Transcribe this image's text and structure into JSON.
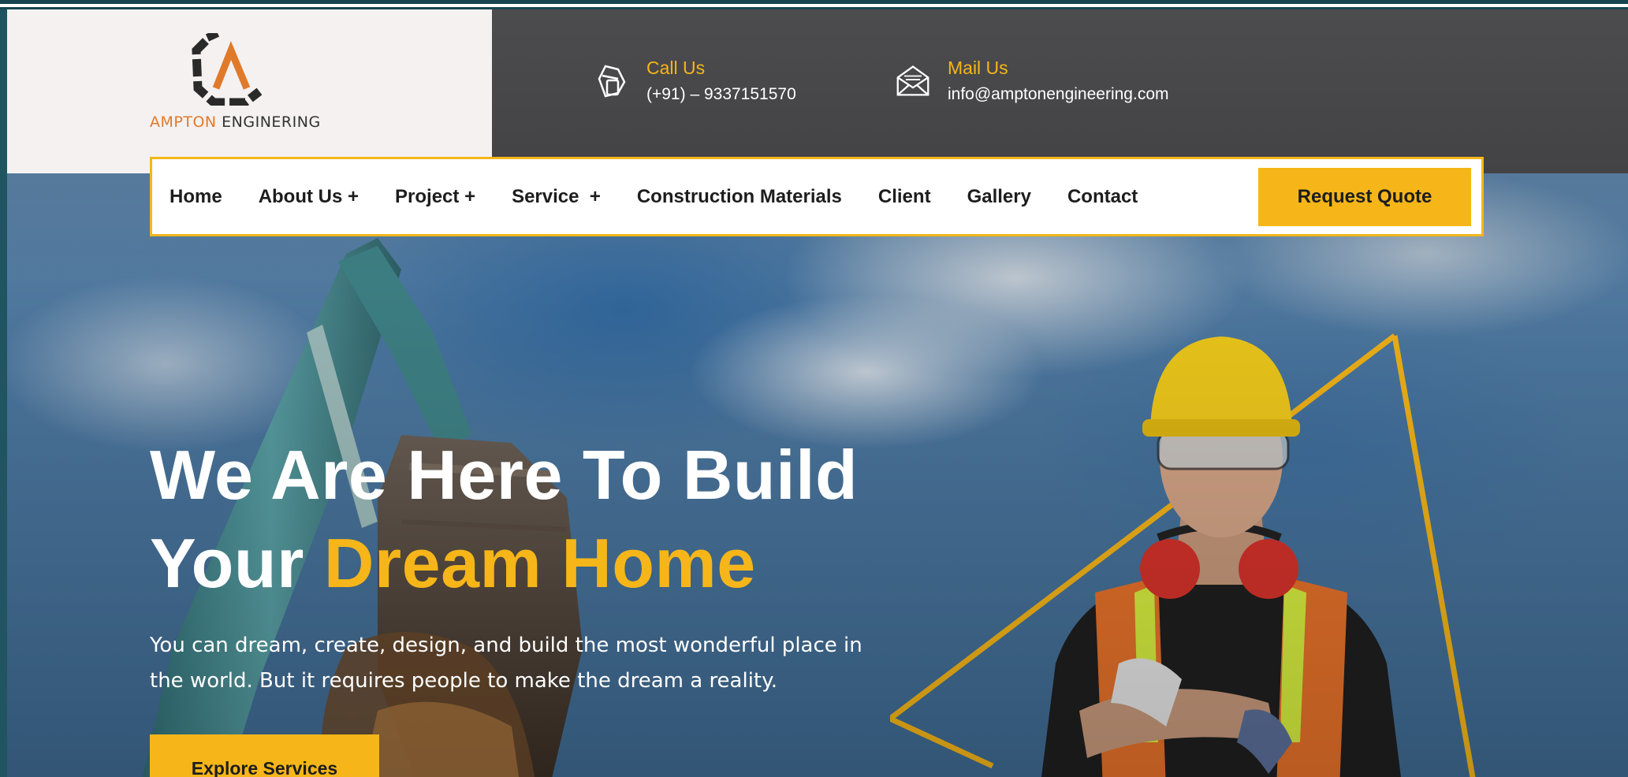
{
  "brand": {
    "name_accent": "AMPTON",
    "name_rest": " ENGINERING",
    "colors": {
      "accent": "#f6b619",
      "logo_orange": "#e07a2b",
      "dark": "#1d1d1d",
      "header_gray": "#484848"
    }
  },
  "contact": {
    "call": {
      "icon": "phone-hand-icon",
      "label": "Call Us",
      "value": "(+91) – 9337151570"
    },
    "mail": {
      "icon": "envelope-icon",
      "label": "Mail Us",
      "value": "info@amptonengineering.com"
    }
  },
  "nav": {
    "items": [
      {
        "label": "Home"
      },
      {
        "label": "About Us +"
      },
      {
        "label": "Project +"
      },
      {
        "label": "Service  +"
      },
      {
        "label": "Construction Materials"
      },
      {
        "label": "Client"
      },
      {
        "label": "Gallery"
      },
      {
        "label": "Contact"
      }
    ],
    "quote_button": "Request Quote"
  },
  "hero": {
    "title_line1": "We Are Here To Build",
    "title_line2_prefix": "Your ",
    "title_line2_highlight": "Dream Home",
    "subtitle_line1": "You can dream, create, design, and build the most wonderful place in",
    "subtitle_line2": "the world. But it requires people to make the dream a reality.",
    "cta": "Explore Services"
  }
}
